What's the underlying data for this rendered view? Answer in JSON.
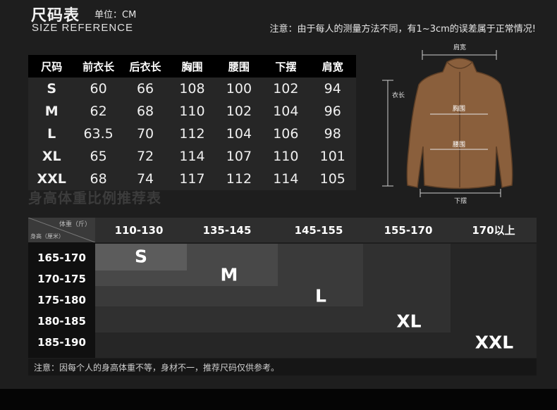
{
  "header": {
    "title_cn": "尺码表",
    "unit": "单位：CM",
    "title_en": "SIZE REFERENCE",
    "note": "注意：由于每人的测量方法不同，有1~3cm的误差属于正常情况!"
  },
  "size_table": {
    "columns": [
      "尺码",
      "前衣长",
      "后衣长",
      "胸围",
      "腰围",
      "下摆",
      "肩宽"
    ],
    "rows": [
      [
        "S",
        "60",
        "66",
        "108",
        "100",
        "102",
        "94"
      ],
      [
        "M",
        "62",
        "68",
        "110",
        "102",
        "104",
        "96"
      ],
      [
        "L",
        "63.5",
        "70",
        "112",
        "104",
        "106",
        "98"
      ],
      [
        "XL",
        "65",
        "72",
        "114",
        "107",
        "110",
        "101"
      ],
      [
        "XXL",
        "68",
        "74",
        "117",
        "112",
        "114",
        "105"
      ]
    ]
  },
  "jacket": {
    "shoulder": "肩宽",
    "length": "衣长",
    "chest": "胸围",
    "waist": "腰围",
    "hem": "下摆",
    "color": "#8a5f3c"
  },
  "weight_chart": {
    "title": "身高体重比例推荐表",
    "corner_weight": "体重（斤）",
    "corner_height": "身高（厘米）",
    "weights": [
      "110-130",
      "135-145",
      "145-155",
      "155-170",
      "170以上"
    ],
    "heights": [
      "165-170",
      "170-175",
      "175-180",
      "180-185",
      "185-190"
    ],
    "sizes": [
      "S",
      "M",
      "L",
      "XL",
      "XXL"
    ]
  },
  "footer": {
    "note": "注意：因每个人的身高体重不等，身材不一，推荐尺码仅供参考。"
  },
  "colors": {
    "background": "#1e1e1e",
    "table_header": "#000000",
    "band_s": "#5c5c5c",
    "band_m": "#484848",
    "band_l": "#3a3a3a",
    "band_xl": "#303030"
  }
}
